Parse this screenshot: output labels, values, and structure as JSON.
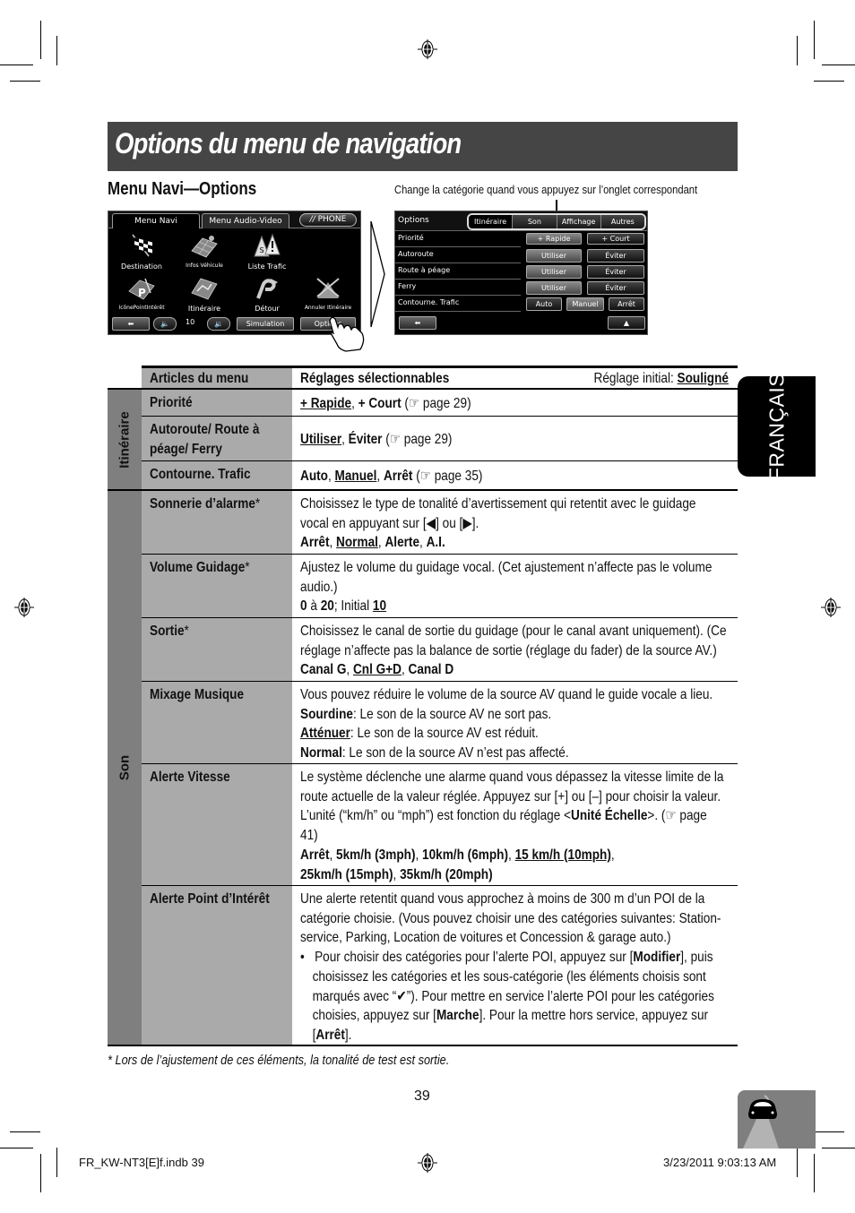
{
  "page": {
    "title": "Options du menu de navigation",
    "section_title": "Menu Navi—Options",
    "callout": "Change la catégorie quand vous appuyez sur l’onglet correspondant",
    "page_number": "39",
    "language_tab": "FRANÇAIS",
    "slug_left": "FR_KW-NT3[E]f.indb   39",
    "slug_right": "3/23/2011   9:03:13 AM",
    "footnote": "*  Lors de l’ajustement de ces éléments, la tonalité de test est sortie."
  },
  "screen_menu": {
    "tabs": [
      "Menu Navi",
      "Menu Audio-Video"
    ],
    "active_tab": "Menu Navi",
    "phone_button": "PHONE",
    "icons": [
      {
        "label": "Destination",
        "icon": "checkered-flag-icon"
      },
      {
        "label": "Infos Véhicule",
        "icon": "vehicle-info-map-icon"
      },
      {
        "label": "Liste Trafic",
        "icon": "traffic-warning-icon"
      },
      {
        "label": "IcônePointIntérêt",
        "icon": "poi-parking-icon"
      },
      {
        "label": "Itinéraire",
        "icon": "route-map-icon"
      },
      {
        "label": "Détour",
        "icon": "detour-icon"
      },
      {
        "label": "Annuler Itinéraire",
        "icon": "cancel-route-icon"
      }
    ],
    "volume_value": "10",
    "simulation_button": "Simulation",
    "options_button": "Options"
  },
  "screen_options": {
    "title": "Options",
    "tabs": [
      "Itinéraire",
      "Son",
      "Affichage",
      "Autres"
    ],
    "active_tab": "Itinéraire",
    "rows": [
      {
        "label": "Priorité",
        "buttons": [
          "+ Rapide",
          "+ Court"
        ],
        "selected": "+ Rapide"
      },
      {
        "label": "Autoroute",
        "buttons": [
          "Utiliser",
          "Éviter"
        ],
        "selected": "Utiliser"
      },
      {
        "label": "Route à péage",
        "buttons": [
          "Utiliser",
          "Éviter"
        ],
        "selected": "Utiliser"
      },
      {
        "label": "Ferry",
        "buttons": [
          "Utiliser",
          "Éviter"
        ],
        "selected": "Utiliser"
      },
      {
        "label": "Contourne. Trafic",
        "buttons": [
          "Auto",
          "Manuel",
          "Arrêt"
        ],
        "selected": "Manuel"
      }
    ]
  },
  "table": {
    "headers": {
      "col1": "Articles du menu",
      "col2": "Réglages sélectionnables",
      "initial_label": "Réglage initial: ",
      "initial_value": "Souligné"
    },
    "groups": [
      {
        "name": "Itinéraire",
        "rows": [
          {
            "item": "Priorité",
            "settings": [
              "+ Rapide",
              "+ Court"
            ],
            "default": "+ Rapide",
            "ref": "page 29"
          },
          {
            "item": "Autoroute/ Route à péage/ Ferry",
            "settings": [
              "Utiliser",
              "Éviter"
            ],
            "default": "Utiliser",
            "ref": "page 29"
          },
          {
            "item": "Contourne. Trafic",
            "settings": [
              "Auto",
              "Manuel",
              "Arrêt"
            ],
            "default": "Manuel",
            "ref": "page 35"
          }
        ]
      },
      {
        "name": "Son",
        "rows": [
          {
            "item": "Sonnerie d’alarme",
            "asterisk": true,
            "text": "Choisissez le type de tonalité d’avertissement qui retentit avec le guidage vocal en appuyant sur [◀] ou [▶].",
            "settings": [
              "Arrêt",
              "Normal",
              "Alerte",
              "A.I."
            ],
            "default": "Normal"
          },
          {
            "item": "Volume Guidage",
            "asterisk": true,
            "text": "Ajustez le volume du guidage vocal. (Cet ajustement n’affecte pas le volume audio.)",
            "range_min": "0",
            "range_max": "20",
            "range_sep": " à ",
            "initial_label": "; Initial ",
            "default": "10"
          },
          {
            "item": "Sortie",
            "asterisk": true,
            "text": "Choisissez le canal de sortie du guidage (pour le canal avant uniquement). (Ce réglage n’affecte pas la balance de sortie (réglage du fader) de la source AV.)",
            "settings": [
              "Canal G",
              "Cnl G+D",
              "Canal D"
            ],
            "default": "Cnl G+D"
          },
          {
            "item": "Mixage Musique",
            "asterisk": false,
            "text": "Vous pouvez réduire le volume de la source AV quand le guide vocale a lieu.",
            "options": [
              {
                "name": "Sourdine",
                "desc": ": Le son de la source AV ne sort pas.",
                "default": false
              },
              {
                "name": "Atténuer",
                "desc": ": Le son de la source AV est réduit.",
                "default": true
              },
              {
                "name": "Normal",
                "desc": ": Le son de la source AV n’est pas affecté.",
                "default": false
              }
            ]
          },
          {
            "item": "Alerte Vitesse",
            "asterisk": false,
            "text_a": "Le système déclenche une alarme quand vous dépassez la vitesse limite de la route actuelle de la valeur réglée. Appuyez sur [+] ou [–] pour choisir la valeur. L’unité (“km/h” ou “mph”) est fonction du réglage <",
            "text_bold": "Unité Échelle",
            "text_b": ">. (☞ page 41)",
            "settings": [
              "Arrêt",
              "5km/h (3mph)",
              "10km/h (6mph)",
              "15 km/h (10mph)",
              "25km/h (15mph)",
              "35km/h (20mph)"
            ],
            "default": "15 km/h (10mph)"
          },
          {
            "item": "Alerte Point d’Intérêt",
            "asterisk": false,
            "text": "Une alerte retentit quand vous approchez à moins de 300 m d’un POI de la catégorie choisie. (Vous pouvez choisir une des catégories suivantes: Station-service, Parking, Location de voitures et Concession & garage auto.)",
            "bullet_1": "Pour choisir des catégories pour l’alerte POI, appuyez sur [",
            "bold_1": "Modifier",
            "bullet_2": "], puis choisissez les catégories et les sous-catégorie (les éléments choisis sont marqués avec “✔”). Pour mettre en service l’alerte POI pour les catégories choisies, appuyez sur [",
            "bold_2": "Marche",
            "bullet_3": "]. Pour la mettre hors service, appuyez sur [",
            "bold_3": "Arrêt",
            "bullet_4": "]."
          }
        ]
      }
    ],
    "ref_glyph": "☞"
  }
}
